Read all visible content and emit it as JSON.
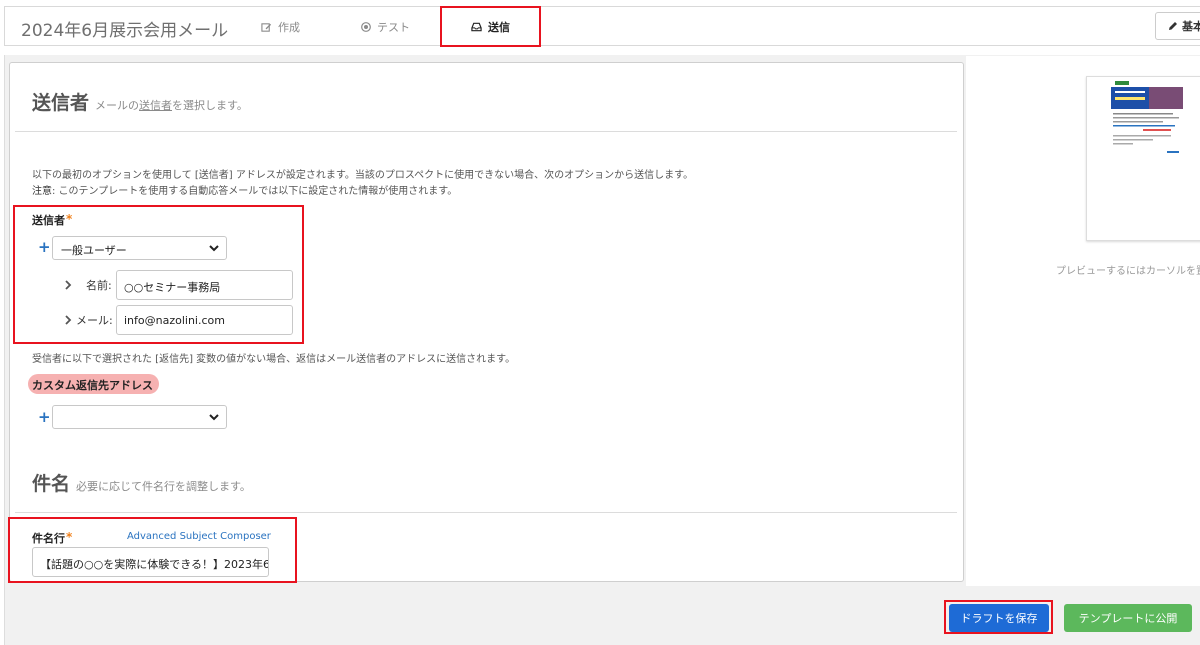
{
  "header": {
    "title": "2024年6月展示会用メール",
    "tabs": [
      {
        "label": "作成",
        "icon": "edit-icon",
        "active": false
      },
      {
        "label": "テスト",
        "icon": "target-icon",
        "active": false
      },
      {
        "label": "送信",
        "icon": "inbox-icon",
        "active": true
      }
    ],
    "settings_label": "基本"
  },
  "sender_section": {
    "title": "送信者",
    "subtitle_prefix": "メールの",
    "subtitle_link": "送信者",
    "subtitle_suffix": "を選択します。",
    "note_line1": "以下の最初のオプションを使用して [送信者] アドレスが設定されます。当該のプロスペクトに使用できない場合、次のオプションから送信します。",
    "note_label": "注意",
    "note_line2": ": このテンプレートを使用する自動応答メールでは以下に設定された情報が使用されます。",
    "field_label": "送信者",
    "select_value": "一般ユーザー",
    "name_label": "名前:",
    "name_value": "○○セミナー事務局",
    "email_label": "メール:",
    "email_value": "info@nazolini.com"
  },
  "reply_section": {
    "note": "受信者に以下で選択された [返信先] 変数の値がない場合、返信はメール送信者のアドレスに送信されます。",
    "field_label": "カスタム返信先アドレス",
    "select_value": ""
  },
  "subject_section": {
    "title": "件名",
    "subtitle": "必要に応じて件名行を調整します。",
    "field_label": "件名行",
    "composer_link": "Advanced Subject Composer",
    "value": "【話題の○○を実際に体験できる！】2023年6"
  },
  "preview": {
    "caption": "プレビューするにはカーソルを置"
  },
  "footer": {
    "save_draft_label": "ドラフトを保存",
    "publish_label": "テンプレートに公開"
  },
  "colors": {
    "accent_blue": "#1e6bd6",
    "publish_green": "#5cb85c",
    "required_orange": "#f0811c",
    "annotation_red": "#e8131f"
  }
}
